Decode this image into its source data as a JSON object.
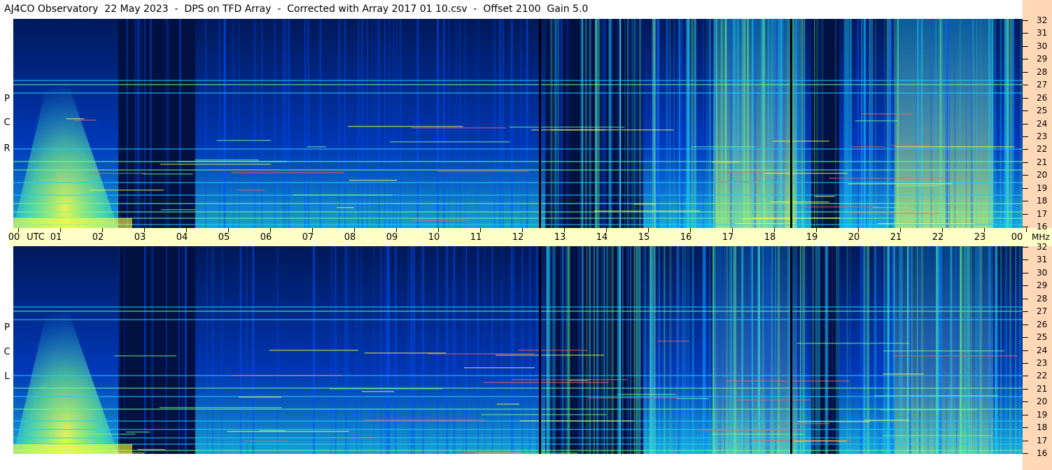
{
  "header": {
    "title": "AJ4CO Observatory  22 May 2023  -  DPS on TFD Array  -  Corrected with Array 2017 01 10.csv  -  Offset 2100  Gain 5.0"
  },
  "panels": {
    "top": {
      "letters": [
        "R",
        "C",
        "P"
      ]
    },
    "bottom": {
      "letters": [
        "L",
        "C",
        "P"
      ]
    }
  },
  "time_axis": {
    "labels": [
      "00",
      "01",
      "02",
      "03",
      "04",
      "05",
      "06",
      "07",
      "08",
      "09",
      "10",
      "11",
      "12",
      "13",
      "14",
      "15",
      "16",
      "17",
      "18",
      "19",
      "20",
      "21",
      "22",
      "23",
      "00"
    ],
    "utc_label": "UTC",
    "unit_label": "MHz"
  },
  "frequency_axis": {
    "labels": [
      "32",
      "31",
      "30",
      "29",
      "28",
      "27",
      "26",
      "25",
      "24",
      "23",
      "22",
      "21",
      "20",
      "19",
      "18",
      "17",
      "16"
    ]
  },
  "colors": {
    "background_dark": "#001040",
    "blue": "#0050ff",
    "cyan": "#20d0ff",
    "green": "#70ff90",
    "yellow": "#ffff40",
    "time_axis_bg": "#ffffc8",
    "scale_bg": "#ffd8b8"
  }
}
